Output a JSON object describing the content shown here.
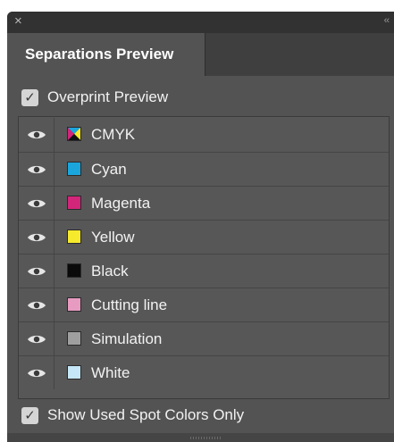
{
  "window": {
    "close_glyph": "×",
    "collapse_glyph": "‹‹"
  },
  "tabs": [
    {
      "label": "Separations Preview",
      "active": true
    }
  ],
  "overprint_preview": {
    "label": "Overprint Preview",
    "checked": true
  },
  "separations": [
    {
      "label": "CMYK",
      "swatch": "cmyk-composite",
      "visible": true
    },
    {
      "label": "Cyan",
      "swatch": "#1aa6dd",
      "visible": true
    },
    {
      "label": "Magenta",
      "swatch": "#d3257a",
      "visible": true
    },
    {
      "label": "Yellow",
      "swatch": "#f6ea2c",
      "visible": true
    },
    {
      "label": "Black",
      "swatch": "#0a0a0a",
      "visible": true
    },
    {
      "label": "Cutting line",
      "swatch": "#e79bc1",
      "visible": true
    },
    {
      "label": "Simulation",
      "swatch": "#9f9f9f",
      "visible": true
    },
    {
      "label": "White",
      "swatch": "#c5e7f7",
      "visible": true
    }
  ],
  "show_used_spot_colors": {
    "label": "Show Used Spot Colors Only",
    "checked": true
  },
  "colors": {
    "panel_bg": "#535353",
    "text": "#f2f2f2"
  }
}
